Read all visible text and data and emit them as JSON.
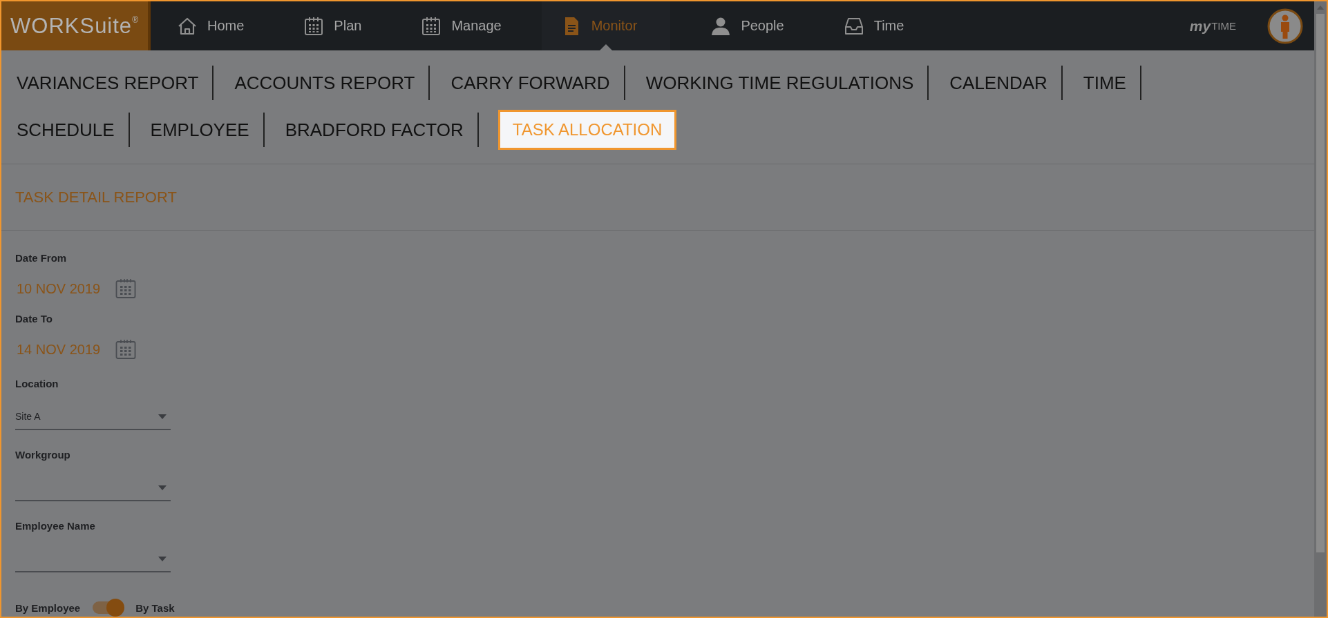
{
  "logo": {
    "text": "WORKSuite",
    "mark": "®"
  },
  "nav": [
    {
      "label": "Home",
      "selected": false
    },
    {
      "label": "Plan",
      "selected": false
    },
    {
      "label": "Manage",
      "selected": false
    },
    {
      "label": "Monitor",
      "selected": true
    },
    {
      "label": "People",
      "selected": false
    },
    {
      "label": "Time",
      "selected": false
    }
  ],
  "brand": {
    "prefix": "my",
    "suffix": "TIME"
  },
  "report_tabs": [
    [
      {
        "label": "VARIANCES REPORT",
        "selected": false
      },
      {
        "label": "ACCOUNTS REPORT",
        "selected": false
      },
      {
        "label": "CARRY FORWARD",
        "selected": false
      },
      {
        "label": "WORKING TIME REGULATIONS",
        "selected": false
      },
      {
        "label": "CALENDAR",
        "selected": false
      },
      {
        "label": "TIME",
        "selected": false
      }
    ],
    [
      {
        "label": "SCHEDULE",
        "selected": false
      },
      {
        "label": "EMPLOYEE",
        "selected": false
      },
      {
        "label": "BRADFORD FACTOR",
        "selected": false
      },
      {
        "label": "TASK ALLOCATION",
        "selected": true
      }
    ]
  ],
  "section_title": "TASK DETAIL REPORT",
  "fields": [
    {
      "kind": "date",
      "label": "Date From",
      "value": "10 NOV 2019"
    },
    {
      "kind": "date",
      "label": "Date To",
      "value": "14 NOV 2019"
    },
    {
      "kind": "select",
      "label": "Location",
      "value": "Site A"
    },
    {
      "kind": "select",
      "label": "Workgroup"
    },
    {
      "kind": "select",
      "label": "Employee Name"
    }
  ],
  "toggle": {
    "left": "By Employee",
    "right": "By Task",
    "on": true
  }
}
